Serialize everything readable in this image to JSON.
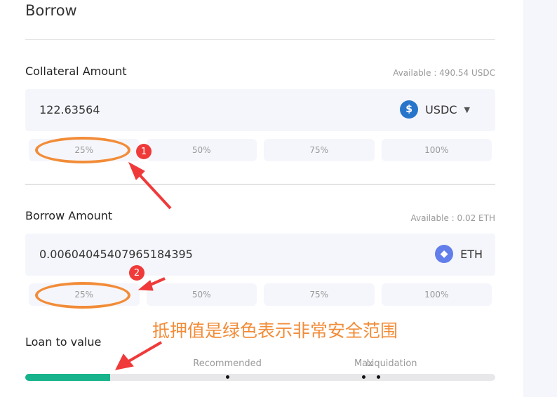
{
  "title": "Borrow",
  "collateral": {
    "label": "Collateral Amount",
    "available": "Available : 490.54 USDC",
    "value": "122.63564",
    "token": "USDC",
    "token_icon": "usdc-icon",
    "token_color": "#2775ca",
    "percents": [
      "25%",
      "50%",
      "75%",
      "100%"
    ]
  },
  "borrow": {
    "label": "Borrow Amount",
    "available": "Available : 0.02 ETH",
    "value": "0.00604045407965184395",
    "token": "ETH",
    "token_icon": "eth-icon",
    "token_color": "#627eea",
    "percents": [
      "25%",
      "50%",
      "75%",
      "100%"
    ]
  },
  "ltv": {
    "label": "Loan to value",
    "current_percent": 18,
    "fill_color": "#16b38c",
    "markers": [
      {
        "label": "Recommended",
        "percent": 43
      },
      {
        "label": "Max",
        "percent": 72
      },
      {
        "label": "Liquidation",
        "percent": 75
      }
    ]
  },
  "annotations": {
    "badge1": "1",
    "badge2": "2",
    "note": "抵押值是绿色表示非常安全范围",
    "accent": "#f28c38"
  }
}
